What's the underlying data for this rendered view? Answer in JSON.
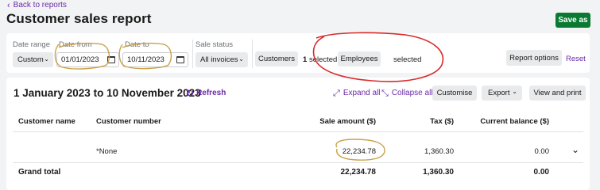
{
  "nav": {
    "back_label": "Back to reports"
  },
  "page": {
    "title": "Customer sales report",
    "save_label": "Save as"
  },
  "filters": {
    "date_range": {
      "label": "Date range",
      "value": "Custom"
    },
    "date_from": {
      "label": "Date from",
      "value": "01/01/2023"
    },
    "date_to": {
      "label": "Date to",
      "value": "10/11/2023"
    },
    "sale_status": {
      "label": "Sale status",
      "value": "All invoices"
    },
    "customers": {
      "button_label": "Customers",
      "selected_count": "1",
      "selected_label": "selected"
    },
    "employees": {
      "button_label": "Employees",
      "selected_label": "selected"
    },
    "report_options_label": "Report options",
    "reset_label": "Reset"
  },
  "report": {
    "range_title": "1 January 2023 to 10 November 2023",
    "refresh_label": "Refresh",
    "expand_label": "Expand all",
    "collapse_label": "Collapse all",
    "customise_label": "Customise",
    "export_label": "Export",
    "view_print_label": "View and print",
    "columns": [
      "Customer name",
      "Customer number",
      "Sale amount ($)",
      "Tax ($)",
      "Current balance ($)"
    ],
    "rows": [
      {
        "customer_name": "",
        "customer_number": "*None",
        "sale_amount": "22,234.78",
        "tax": "1,360.30",
        "balance": "0.00"
      }
    ],
    "total": {
      "label": "Grand total",
      "sale_amount": "22,234.78",
      "tax": "1,360.30",
      "balance": "0.00"
    }
  },
  "colors": {
    "accent": "#6b2aa8",
    "save": "#0a7a33",
    "annotation_red": "#d92b2b",
    "annotation_gold": "#c9a24a"
  }
}
